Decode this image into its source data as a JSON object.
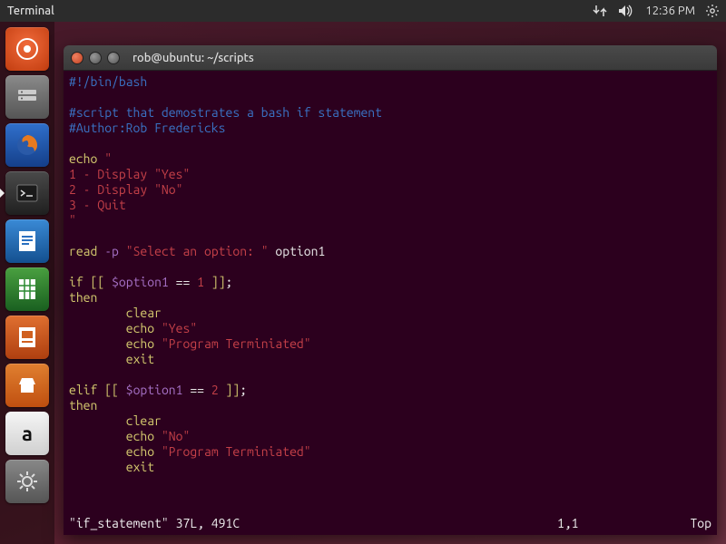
{
  "top_panel": {
    "app_label": "Terminal",
    "time": "12:36 PM"
  },
  "launcher": {
    "amazon_glyph": "a"
  },
  "window": {
    "title": "rob@ubuntu: ~/scripts"
  },
  "code": {
    "shebang": "#!/bin/bash",
    "comment_desc": "#script that demostrates a bash if statement",
    "comment_author": "#Author:Rob Fredericks",
    "echo_kw": "echo",
    "dquote": "\"",
    "menu1": "1 - Display \"Yes\"",
    "menu2": "2 - Display \"No\"",
    "menu3": "3 - Quit",
    "read_kw": "read",
    "read_opt": "-p",
    "read_prompt": "\"Select an option: \"",
    "read_var": " option1",
    "if_kw": "if",
    "bracket_open": "[[ ",
    "optvar": "$option1",
    "eqeq": " == ",
    "one": "1",
    "two": "2",
    "bracket_close": " ]]",
    "semicolon": ";",
    "then_kw": "then",
    "indent": "        ",
    "clear_kw": "clear",
    "yes_str": "\"Yes\"",
    "no_str": "\"No\"",
    "term_str": "\"Program Terminiated\"",
    "exit_kw": "exit",
    "elif_kw": "elif"
  },
  "vim": {
    "fileinfo": "\"if_statement\" 37L, 491C",
    "position": "1,1",
    "scroll": "Top"
  }
}
